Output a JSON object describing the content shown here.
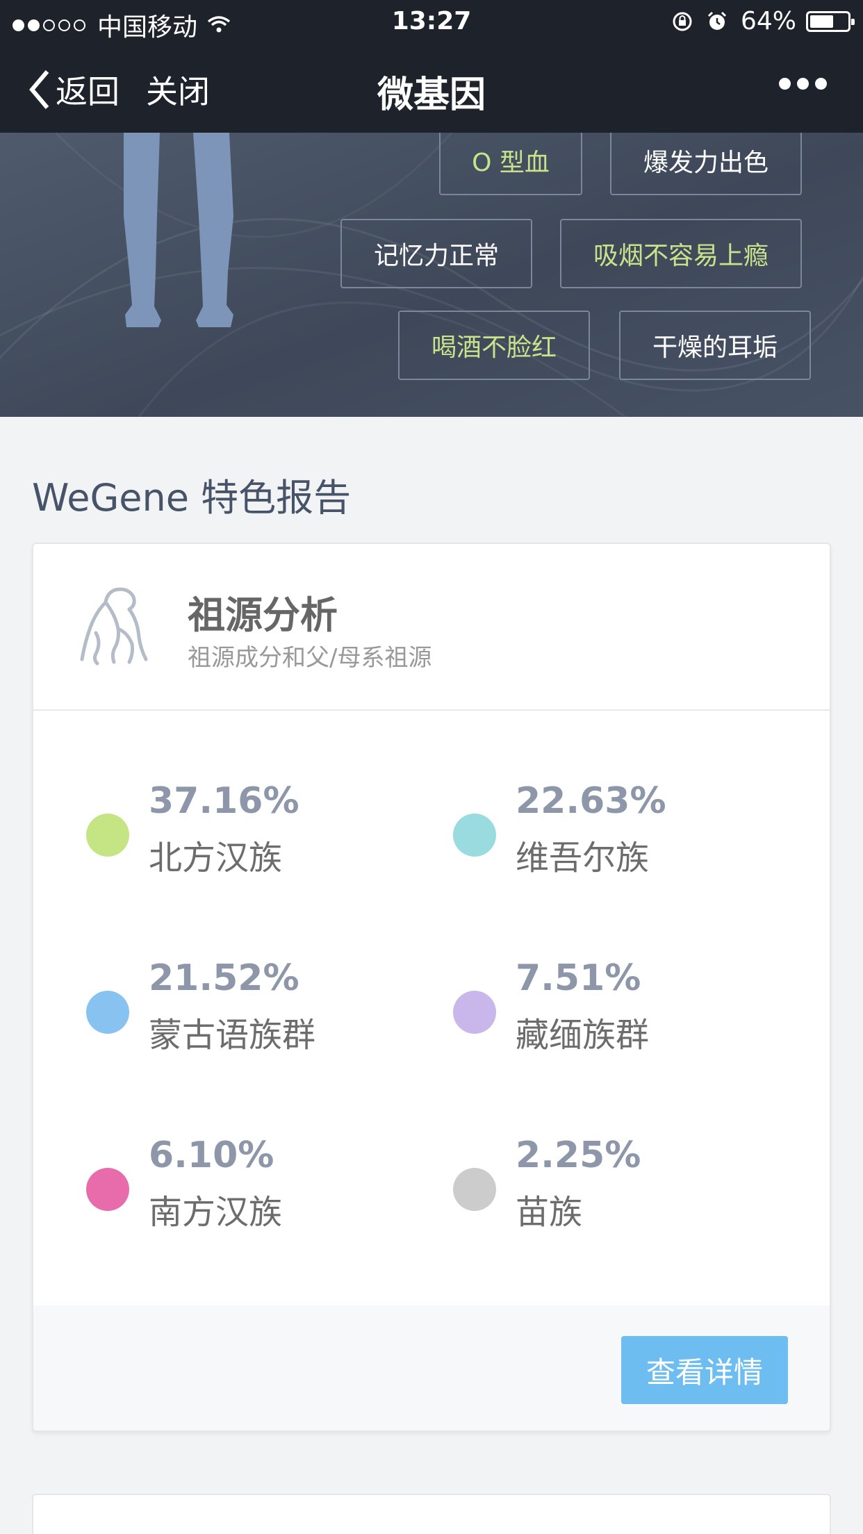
{
  "status_bar": {
    "carrier": "中国移动",
    "time": "13:27",
    "battery": "64%",
    "battery_level": 0.64,
    "signal_dots_filled": 2,
    "signal_dots_total": 5
  },
  "nav": {
    "back_label": "返回",
    "close_label": "关闭",
    "title": "微基因"
  },
  "hero": {
    "tags": [
      {
        "label": "O 型血",
        "highlight": true
      },
      {
        "label": "爆发力出色",
        "highlight": false
      },
      {
        "label": "记忆力正常",
        "highlight": false
      },
      {
        "label": "吸烟不容易上瘾",
        "highlight": true
      },
      {
        "label": "喝酒不脸红",
        "highlight": true
      },
      {
        "label": "干燥的耳垢",
        "highlight": false
      }
    ]
  },
  "section": {
    "title": "WeGene 特色报告"
  },
  "ancestry_card": {
    "icon": "ape-icon",
    "title": "祖源分析",
    "subtitle": "祖源成分和父/母系祖源",
    "items": [
      {
        "percent": "37.16%",
        "name": "北方汉族",
        "color": "#c5e484"
      },
      {
        "percent": "22.63%",
        "name": "维吾尔族",
        "color": "#9adbe0"
      },
      {
        "percent": "21.52%",
        "name": "蒙古语族群",
        "color": "#88c2f0"
      },
      {
        "percent": "7.51%",
        "name": "藏缅族群",
        "color": "#c9b7ec"
      },
      {
        "percent": "6.10%",
        "name": "南方汉族",
        "color": "#e86cab"
      },
      {
        "percent": "2.25%",
        "name": "苗族",
        "color": "#cccccc"
      }
    ],
    "detail_button": "查看详情"
  },
  "colors": {
    "nav_bg": "#1d222b",
    "tag_highlight": "#c8e38c",
    "button": "#6dbdf0"
  }
}
